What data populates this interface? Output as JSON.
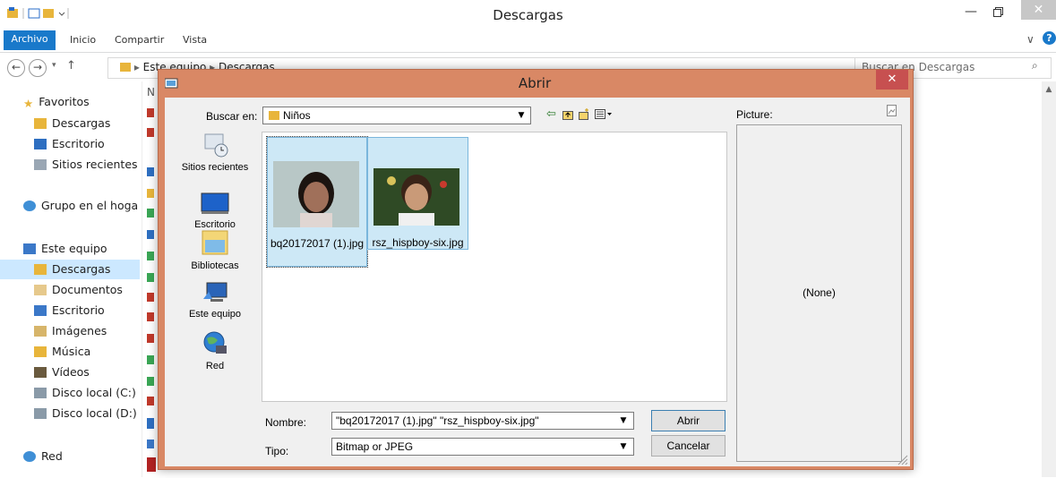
{
  "explorer": {
    "title": "Descargas",
    "ribbon_tabs": [
      "Archivo",
      "Inicio",
      "Compartir",
      "Vista"
    ],
    "address": [
      "Este equipo",
      "Descargas"
    ],
    "search_placeholder": "Buscar en Descargas",
    "nav": {
      "favoritos": "Favoritos",
      "descargas": "Descargas",
      "escritorio": "Escritorio",
      "sitios_recientes": "Sitios recientes",
      "grupo_hogar": "Grupo en el hoga",
      "este_equipo": "Este equipo",
      "pc_descargas": "Descargas",
      "documentos": "Documentos",
      "pc_escritorio": "Escritorio",
      "imagenes": "Imágenes",
      "musica": "Música",
      "videos": "Vídeos",
      "disco_c": "Disco local (C:)",
      "disco_d": "Disco local (D:)",
      "red": "Red"
    },
    "column_partial": "N"
  },
  "dialog": {
    "title": "Abrir",
    "close_glyph": "✕",
    "look_in_label": "Buscar en:",
    "look_in_value": "Niños",
    "places": [
      {
        "label": "Sitios recientes",
        "icon": "recent-places-icon"
      },
      {
        "label": "Escritorio",
        "icon": "desktop-icon"
      },
      {
        "label": "Bibliotecas",
        "icon": "libraries-icon"
      },
      {
        "label": "Este equipo",
        "icon": "computer-icon"
      },
      {
        "label": "Red",
        "icon": "network-icon"
      }
    ],
    "files": [
      {
        "name": "bq20172017 (1).jpg",
        "thumb": "girl-photo"
      },
      {
        "name": "rsz_hispboy-six.jpg",
        "thumb": "boy-photo"
      }
    ],
    "filename_label": "Nombre:",
    "filename_value": "\"bq20172017 (1).jpg\" \"rsz_hispboy-six.jpg\"",
    "filetype_label": "Tipo:",
    "filetype_value": "Bitmap or JPEG",
    "open_button": "Abrir",
    "cancel_button": "Cancelar",
    "preview_label": "Picture:",
    "preview_none": "(None)"
  }
}
